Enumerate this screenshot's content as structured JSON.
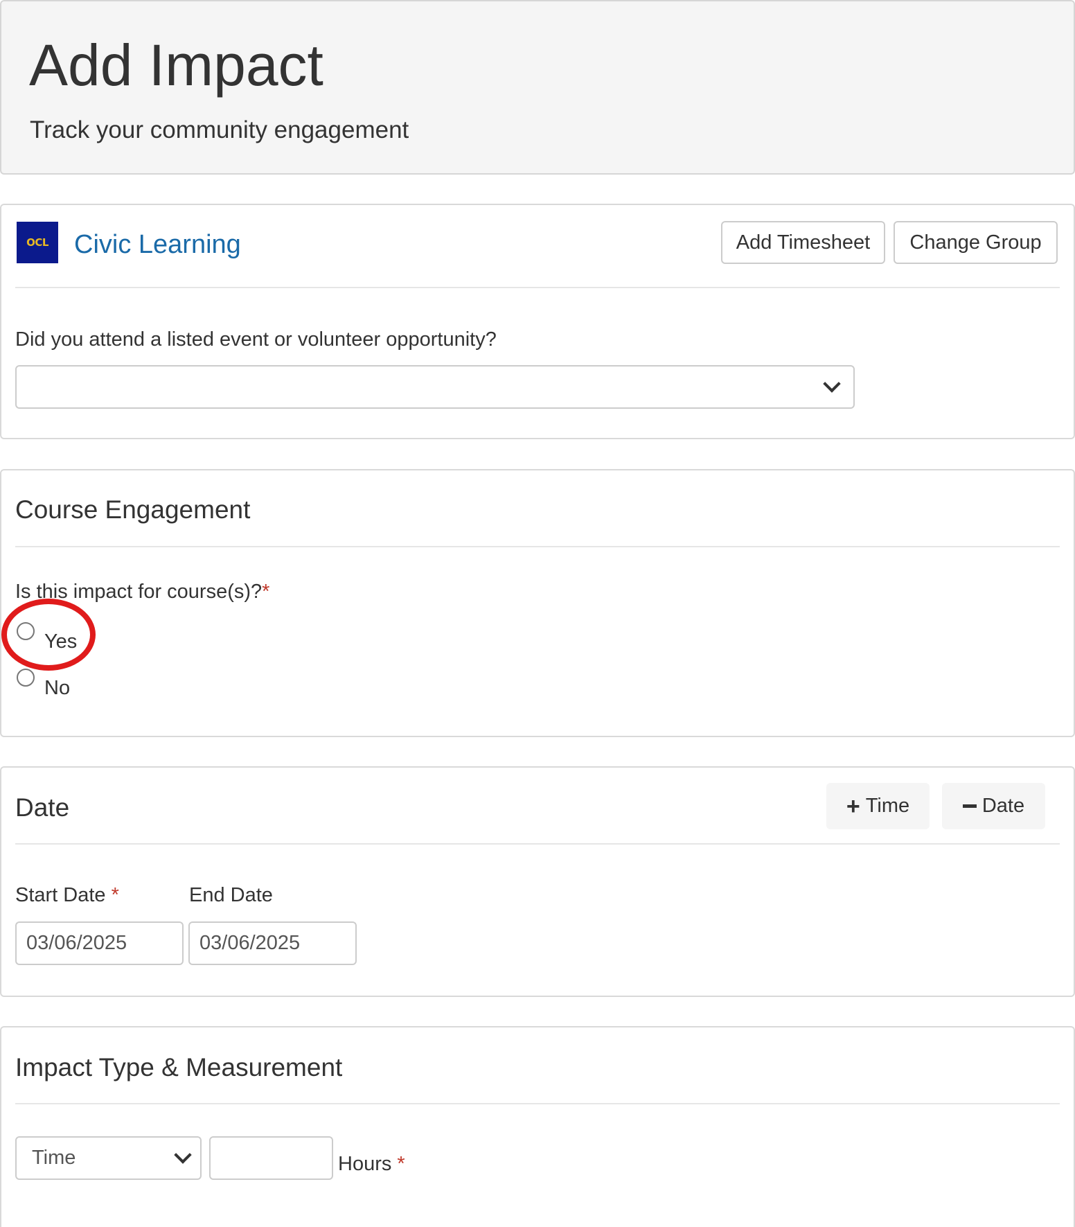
{
  "header": {
    "title": "Add Impact",
    "subtitle": "Track your community engagement"
  },
  "group": {
    "logo_text": "OCL",
    "name": "Civic Learning",
    "add_timesheet_label": "Add Timesheet",
    "change_group_label": "Change Group",
    "event_question": "Did you attend a listed event or volunteer opportunity?",
    "event_select_value": ""
  },
  "course": {
    "heading": "Course Engagement",
    "question": "Is this impact for course(s)?",
    "required_mark": "*",
    "options": [
      "Yes",
      "No"
    ]
  },
  "date": {
    "heading": "Date",
    "add_time_label": "Time",
    "remove_date_label": "Date",
    "start_label": "Start Date",
    "required_mark": "*",
    "end_label": "End Date",
    "start_value": "03/06/2025",
    "end_value": "03/06/2025"
  },
  "impact": {
    "heading": "Impact Type & Measurement",
    "type_value": "Time",
    "amount_value": "",
    "unit_label": "Hours",
    "required_mark": "*"
  },
  "colors": {
    "link": "#1a6aa8",
    "required": "#c0392b",
    "annotation": "#e01b1b"
  }
}
